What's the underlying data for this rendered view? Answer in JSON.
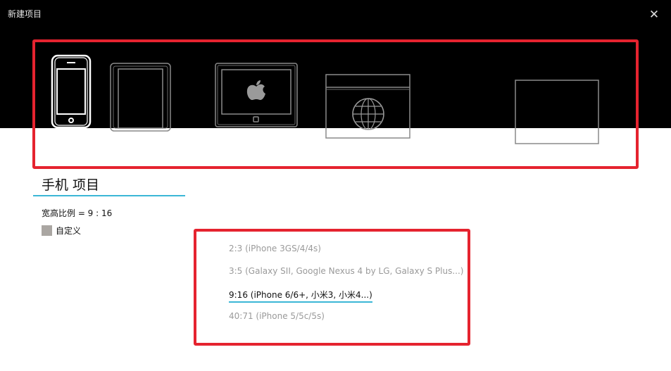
{
  "dialog": {
    "title": "新建项目",
    "close_symbol": "✕"
  },
  "devices": [
    {
      "id": "phone",
      "icon": "phone-icon",
      "selected": true
    },
    {
      "id": "tablet",
      "icon": "tablet-icon",
      "selected": false
    },
    {
      "id": "apple-tv",
      "icon": "apple-tv-icon",
      "selected": false
    },
    {
      "id": "web",
      "icon": "web-globe-icon",
      "selected": false
    },
    {
      "id": "custom-screen",
      "icon": "screen-icon",
      "selected": false
    }
  ],
  "project": {
    "title": "手机 项目",
    "ratio_text": "宽高比例 = 9 : 16",
    "custom_label": "自定义"
  },
  "ratio_options": [
    {
      "label": "2:3 (iPhone 3GS/4/4s)",
      "selected": false
    },
    {
      "label": "3:5 (Galaxy SII, Google Nexus 4 by LG, Galaxy S Plus...)",
      "selected": false
    },
    {
      "label": "9:16 (iPhone 6/6+, 小米3, 小米4...)",
      "selected": true
    },
    {
      "label": "40:71 (iPhone 5/5c/5s)",
      "selected": false
    }
  ],
  "colors": {
    "highlight": "#e5232f",
    "accent_underline": "#3bb7d6",
    "top_background": "#000000",
    "custom_swatch": "#aaa6a2"
  }
}
